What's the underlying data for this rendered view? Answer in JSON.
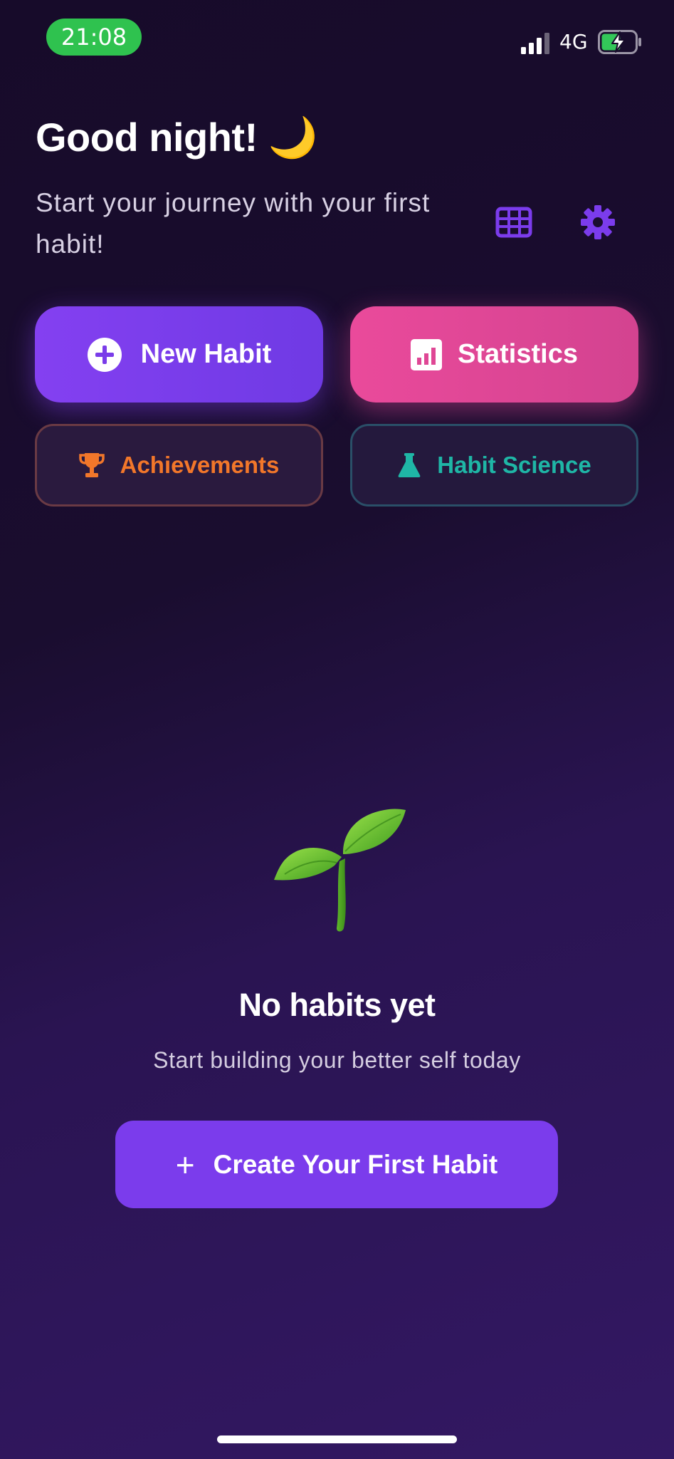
{
  "status_bar": {
    "time": "21:08",
    "network": "4G",
    "icons": [
      "signal-icon",
      "battery-charging-icon"
    ],
    "time_pill_color": "#2fc24f"
  },
  "header": {
    "greeting": "Good night! 🌙",
    "subtitle": "Start your journey with your first habit!",
    "icons": [
      "grid-icon",
      "gear-icon"
    ],
    "icon_color": "#7b3cec"
  },
  "actions": {
    "new_habit": {
      "label": "New Habit",
      "icon": "plus-circle-icon"
    },
    "statistics": {
      "label": "Statistics",
      "icon": "bar-chart-icon"
    },
    "achievements": {
      "label": "Achievements",
      "icon": "trophy-icon",
      "color": "#f2772a"
    },
    "habit_science": {
      "label": "Habit Science",
      "icon": "flask-icon",
      "color": "#1fb6a6"
    }
  },
  "empty_state": {
    "illustration": "sprout-icon",
    "title": "No habits yet",
    "subtitle": "Start building your better self today",
    "cta_label": "Create Your First Habit",
    "cta_icon": "plus-icon"
  },
  "colors": {
    "primary": "#7b3cec",
    "pink": "#ea4a9b",
    "background_top": "#170b2a",
    "background_bottom": "#331863"
  }
}
